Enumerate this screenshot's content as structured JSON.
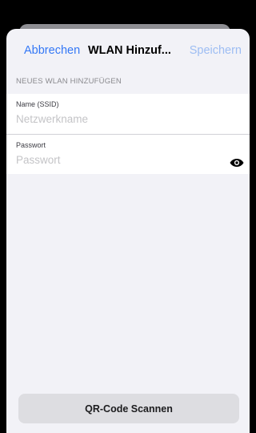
{
  "navbar": {
    "cancel_label": "Abbrechen",
    "title": "WLAN Hinzuf...",
    "save_label": "Speichern"
  },
  "form": {
    "section_header": "NEUES WLAN HINZUFÜGEN",
    "ssid": {
      "label": "Name (SSID)",
      "placeholder": "Netzwerkname",
      "value": ""
    },
    "password": {
      "label": "Passwort",
      "placeholder": "Passwort",
      "value": ""
    }
  },
  "scan_label": "QR-Code Scannen",
  "colors": {
    "accent": "#3478f6",
    "accent_disabled": "#9dbdf3",
    "background": "#f2f2f7"
  },
  "icons": {
    "password_toggle": "eye-icon"
  }
}
